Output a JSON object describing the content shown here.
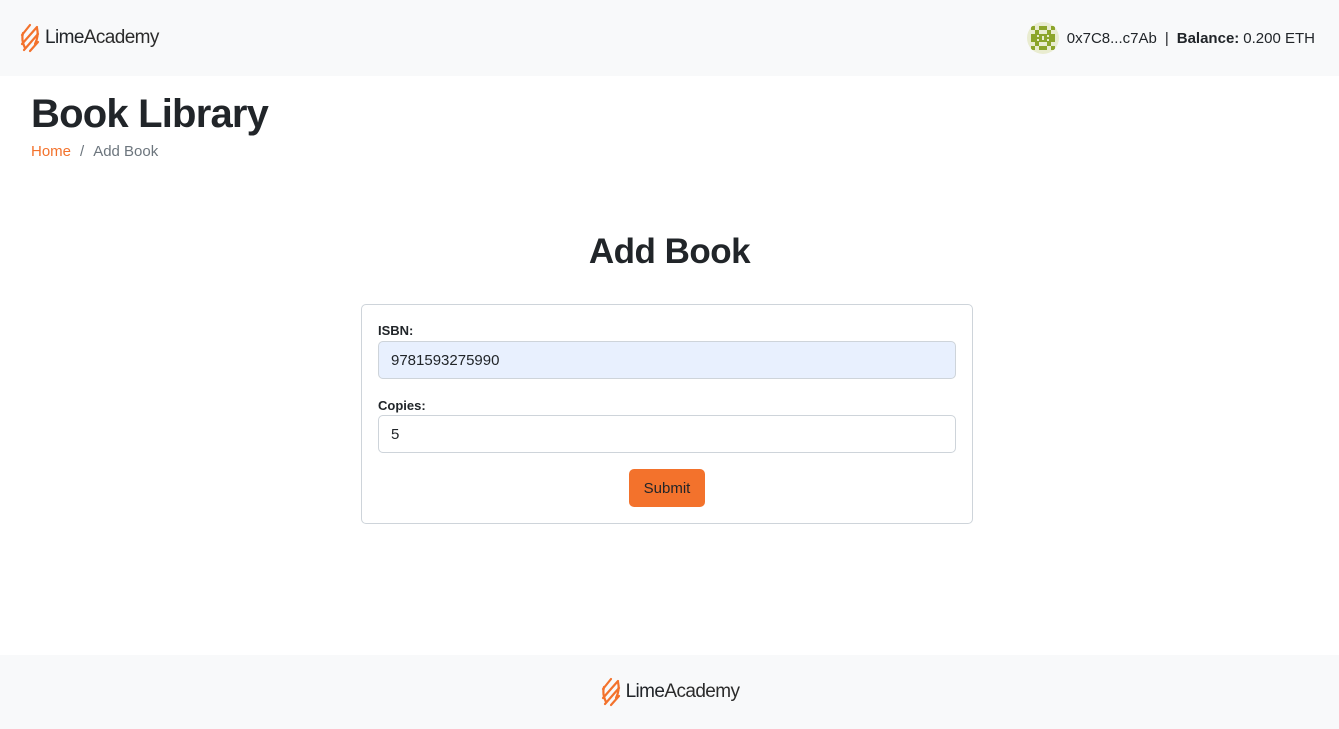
{
  "brand": {
    "lime": "Lime",
    "academy": "Academy",
    "accent_color": "#f3722c"
  },
  "wallet": {
    "avatar_icon": "identicon-avatar",
    "address": "0x7C8...c7Ab",
    "separator": "|",
    "balance_label": "Balance:",
    "balance_value": "0.200 ETH"
  },
  "page": {
    "title": "Book Library"
  },
  "breadcrumb": {
    "home": "Home",
    "separator": "/",
    "current": "Add Book"
  },
  "form": {
    "title": "Add Book",
    "isbn_label": "ISBN:",
    "isbn_value": "9781593275990",
    "copies_label": "Copies:",
    "copies_value": "5",
    "submit_label": "Submit"
  }
}
